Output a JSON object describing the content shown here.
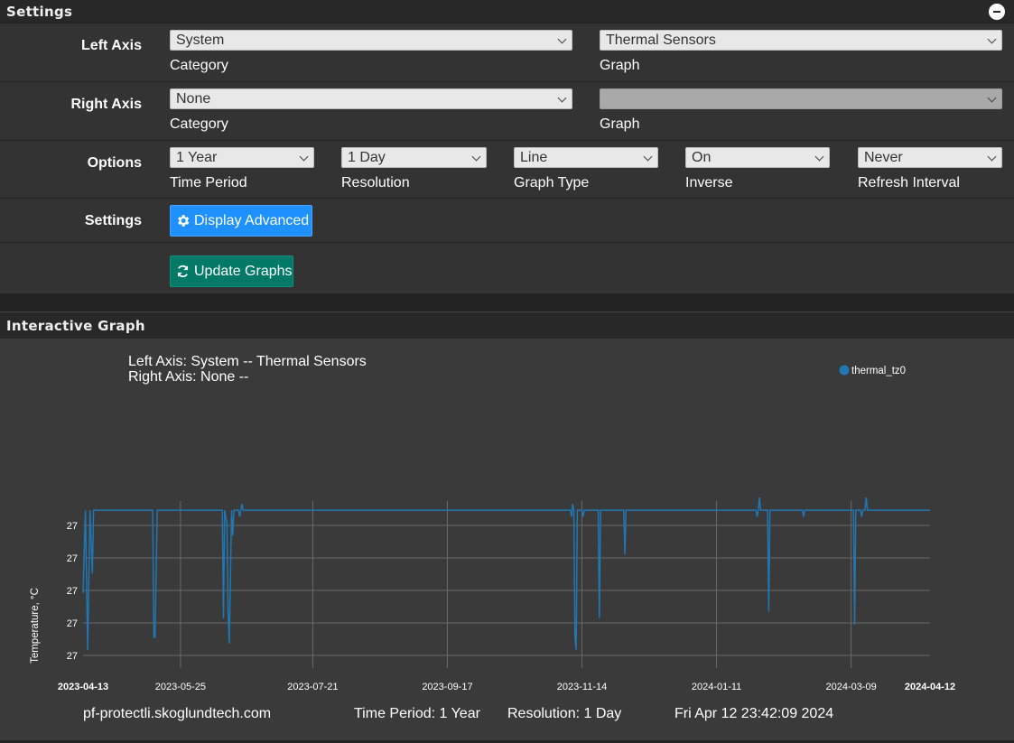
{
  "settings_panel": {
    "title": "Settings",
    "left_axis": {
      "label": "Left Axis",
      "category_value": "System",
      "category_label": "Category",
      "graph_value": "Thermal Sensors",
      "graph_label": "Graph"
    },
    "right_axis": {
      "label": "Right Axis",
      "category_value": "None",
      "category_label": "Category",
      "graph_value": "",
      "graph_label": "Graph"
    },
    "options": {
      "label": "Options",
      "time_period_value": "1 Year",
      "time_period_label": "Time Period",
      "resolution_value": "1 Day",
      "resolution_label": "Resolution",
      "graph_type_value": "Line",
      "graph_type_label": "Graph Type",
      "inverse_value": "On",
      "inverse_label": "Inverse",
      "refresh_value": "Never",
      "refresh_label": "Refresh Interval"
    },
    "settings_row": {
      "label": "Settings",
      "display_advanced": "Display Advanced"
    },
    "update_graphs": "Update Graphs"
  },
  "graph_panel": {
    "title": "Interactive Graph",
    "header_line1": "Left Axis: System -- Thermal Sensors",
    "header_line2": "Right Axis: None --",
    "footer": {
      "host": "pf-protectli.skoglundtech.com",
      "period": "Time Period: 1 Year",
      "resolution": "Resolution: 1 Day",
      "timestamp": "Fri Apr 12 23:42:09 2024"
    }
  },
  "colors": {
    "series": "#1f77b4",
    "button_blue": "#1e90ff",
    "button_green": "#007a66"
  },
  "icons": {
    "collapse": "minus-circle-icon",
    "advanced": "gear-icon",
    "update": "refresh-icon"
  },
  "chart_data": {
    "type": "line",
    "ylabel": "Temperature, °C",
    "y_tick_labels": [
      "27",
      "27",
      "27",
      "27",
      "27"
    ],
    "x_tick_labels": [
      "2023-04-13",
      "2023-05-25",
      "2023-07-21",
      "2023-09-17",
      "2023-11-14",
      "2024-01-11",
      "2024-03-09",
      "2024-04-12"
    ],
    "x_tick_days": [
      0,
      42,
      99,
      157,
      215,
      273,
      331,
      365
    ],
    "grid": true,
    "legend": {
      "position": "top-right"
    },
    "series": [
      {
        "name": "thermal_tz0",
        "color": "#1f77b4",
        "points": [
          [
            0,
            26.87
          ],
          [
            1,
            27.0
          ],
          [
            2,
            26.78
          ],
          [
            3,
            27.0
          ],
          [
            4,
            26.9
          ],
          [
            4.5,
            27.0
          ],
          [
            5,
            27.0
          ],
          [
            30,
            27.0
          ],
          [
            30.5,
            26.8
          ],
          [
            31,
            26.8
          ],
          [
            32,
            27.0
          ],
          [
            60,
            27.0
          ],
          [
            60.5,
            26.83
          ],
          [
            61,
            27.0
          ],
          [
            62,
            26.98
          ],
          [
            62.5,
            26.84
          ],
          [
            63,
            26.79
          ],
          [
            64,
            27.0
          ],
          [
            64.5,
            26.96
          ],
          [
            65,
            27.0
          ],
          [
            67,
            27.0
          ],
          [
            67.5,
            26.99
          ],
          [
            68,
            27.0
          ],
          [
            68.5,
            27.01
          ],
          [
            69,
            27.0
          ],
          [
            150,
            27.0
          ],
          [
            210,
            27.0
          ],
          [
            210.5,
            26.99
          ],
          [
            211,
            27.01
          ],
          [
            211.5,
            27.0
          ],
          [
            212,
            26.8
          ],
          [
            212.5,
            26.78
          ],
          [
            213,
            27.0
          ],
          [
            215,
            27.0
          ],
          [
            215.5,
            26.99
          ],
          [
            216,
            27.0
          ],
          [
            222,
            27.0
          ],
          [
            222.5,
            26.83
          ],
          [
            223,
            27.0
          ],
          [
            233,
            27.0
          ],
          [
            233.5,
            26.93
          ],
          [
            234,
            27.0
          ],
          [
            285,
            27.0
          ],
          [
            290,
            27.0
          ],
          [
            290.5,
            26.99
          ],
          [
            291,
            27.0
          ],
          [
            291.5,
            27.02
          ],
          [
            292,
            27.0
          ],
          [
            295,
            27.0
          ],
          [
            295.5,
            26.84
          ],
          [
            296,
            27.0
          ],
          [
            310,
            27.0
          ],
          [
            310.5,
            26.99
          ],
          [
            311,
            27.0
          ],
          [
            332,
            27.0
          ],
          [
            332.5,
            26.82
          ],
          [
            333,
            27.0
          ],
          [
            335,
            27.0
          ],
          [
            335.5,
            26.99
          ],
          [
            336,
            27.0
          ],
          [
            337,
            27.0
          ],
          [
            337.5,
            27.02
          ],
          [
            338,
            27.0
          ],
          [
            340,
            27.0
          ],
          [
            365,
            27.0
          ]
        ]
      }
    ]
  }
}
